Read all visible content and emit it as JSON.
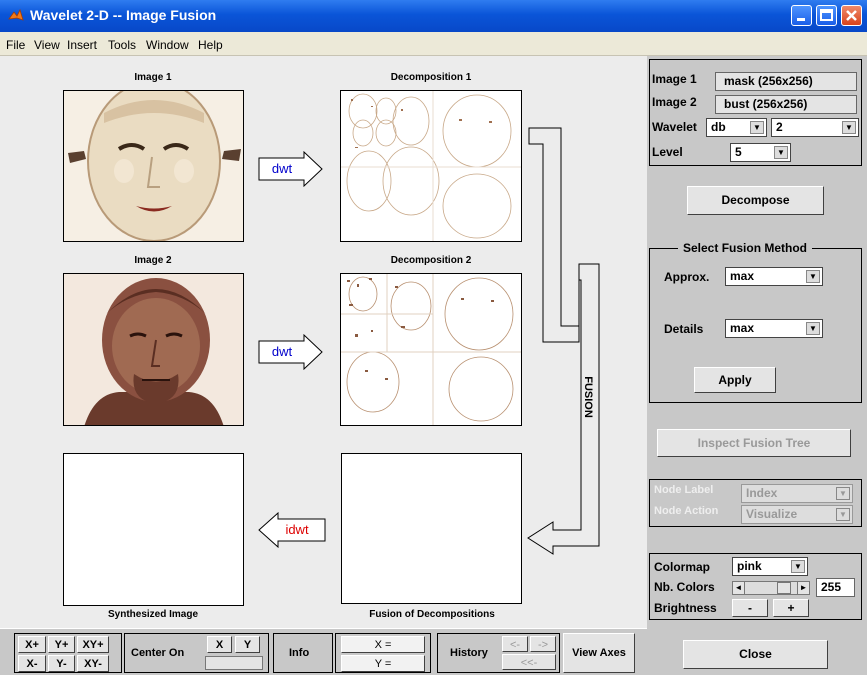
{
  "window": {
    "title": "Wavelet 2-D -- Image Fusion"
  },
  "menu": [
    "File",
    "View",
    "Insert",
    "Tools",
    "Window",
    "Help"
  ],
  "images": {
    "image1": "Image 1",
    "decomp1": "Decomposition 1",
    "image2": "Image 2",
    "decomp2": "Decomposition 2",
    "synth": "Synthesized Image",
    "fusion": "Fusion of Decompositions"
  },
  "arrows": {
    "dwt": "dwt",
    "idwt": "idwt",
    "fusion": "FUSION"
  },
  "info": {
    "image1_label": "Image 1",
    "image1_value": "mask  (256x256)",
    "image2_label": "Image 2",
    "image2_value": "bust  (256x256)",
    "wavelet_label": "Wavelet",
    "wavelet_family": "db",
    "wavelet_order": "2",
    "level_label": "Level",
    "level_value": "5"
  },
  "decompose_btn": "Decompose",
  "fusion_method": {
    "title": "Select Fusion Method",
    "approx_label": "Approx.",
    "approx_value": "max",
    "details_label": "Details",
    "details_value": "max",
    "apply_btn": "Apply"
  },
  "inspect_btn": "Inspect Fusion Tree",
  "node": {
    "label_label": "Node Label",
    "label_value": "Index",
    "action_label": "Node Action",
    "action_value": "Visualize"
  },
  "color": {
    "colormap_label": "Colormap",
    "colormap_value": "pink",
    "nb_label": "Nb. Colors",
    "nb_value": "255",
    "brightness_label": "Brightness",
    "minus": "-",
    "plus": "+"
  },
  "close_btn": "Close",
  "bottom": {
    "xplus": "X+",
    "yplus": "Y+",
    "xyplus": "XY+",
    "xminus": "X-",
    "yminus": "Y-",
    "xyminus": "XY-",
    "center_on": "Center On",
    "x": "X",
    "y": "Y",
    "info": "Info",
    "xeq": "X =",
    "yeq": "Y =",
    "history": "History",
    "hback": "<-",
    "hfwd": "->",
    "hreset": "<<-",
    "view_axes": "View Axes"
  },
  "colors": {
    "titlebar": "#0a55d8",
    "panel": "#c8c8c8",
    "dwt": "#0000cc",
    "idwt": "#dd0000"
  },
  "icons": [
    "matlab-icon",
    "minimize-icon",
    "maximize-icon",
    "close-icon",
    "chevron-down-icon",
    "arrow-left-icon",
    "arrow-right-icon"
  ]
}
